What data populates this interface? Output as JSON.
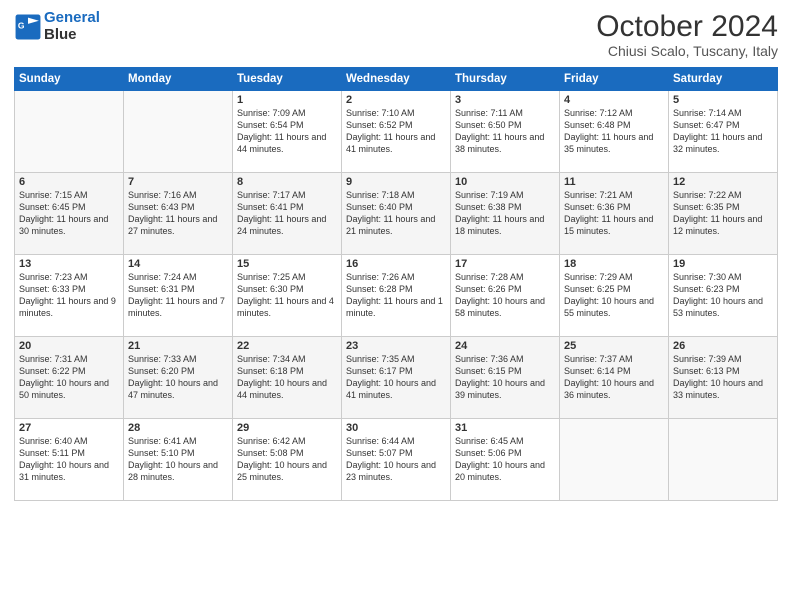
{
  "logo": {
    "line1": "General",
    "line2": "Blue"
  },
  "title": "October 2024",
  "subtitle": "Chiusi Scalo, Tuscany, Italy",
  "days_header": [
    "Sunday",
    "Monday",
    "Tuesday",
    "Wednesday",
    "Thursday",
    "Friday",
    "Saturday"
  ],
  "weeks": [
    [
      {
        "num": "",
        "text": ""
      },
      {
        "num": "",
        "text": ""
      },
      {
        "num": "1",
        "text": "Sunrise: 7:09 AM\nSunset: 6:54 PM\nDaylight: 11 hours and 44 minutes."
      },
      {
        "num": "2",
        "text": "Sunrise: 7:10 AM\nSunset: 6:52 PM\nDaylight: 11 hours and 41 minutes."
      },
      {
        "num": "3",
        "text": "Sunrise: 7:11 AM\nSunset: 6:50 PM\nDaylight: 11 hours and 38 minutes."
      },
      {
        "num": "4",
        "text": "Sunrise: 7:12 AM\nSunset: 6:48 PM\nDaylight: 11 hours and 35 minutes."
      },
      {
        "num": "5",
        "text": "Sunrise: 7:14 AM\nSunset: 6:47 PM\nDaylight: 11 hours and 32 minutes."
      }
    ],
    [
      {
        "num": "6",
        "text": "Sunrise: 7:15 AM\nSunset: 6:45 PM\nDaylight: 11 hours and 30 minutes."
      },
      {
        "num": "7",
        "text": "Sunrise: 7:16 AM\nSunset: 6:43 PM\nDaylight: 11 hours and 27 minutes."
      },
      {
        "num": "8",
        "text": "Sunrise: 7:17 AM\nSunset: 6:41 PM\nDaylight: 11 hours and 24 minutes."
      },
      {
        "num": "9",
        "text": "Sunrise: 7:18 AM\nSunset: 6:40 PM\nDaylight: 11 hours and 21 minutes."
      },
      {
        "num": "10",
        "text": "Sunrise: 7:19 AM\nSunset: 6:38 PM\nDaylight: 11 hours and 18 minutes."
      },
      {
        "num": "11",
        "text": "Sunrise: 7:21 AM\nSunset: 6:36 PM\nDaylight: 11 hours and 15 minutes."
      },
      {
        "num": "12",
        "text": "Sunrise: 7:22 AM\nSunset: 6:35 PM\nDaylight: 11 hours and 12 minutes."
      }
    ],
    [
      {
        "num": "13",
        "text": "Sunrise: 7:23 AM\nSunset: 6:33 PM\nDaylight: 11 hours and 9 minutes."
      },
      {
        "num": "14",
        "text": "Sunrise: 7:24 AM\nSunset: 6:31 PM\nDaylight: 11 hours and 7 minutes."
      },
      {
        "num": "15",
        "text": "Sunrise: 7:25 AM\nSunset: 6:30 PM\nDaylight: 11 hours and 4 minutes."
      },
      {
        "num": "16",
        "text": "Sunrise: 7:26 AM\nSunset: 6:28 PM\nDaylight: 11 hours and 1 minute."
      },
      {
        "num": "17",
        "text": "Sunrise: 7:28 AM\nSunset: 6:26 PM\nDaylight: 10 hours and 58 minutes."
      },
      {
        "num": "18",
        "text": "Sunrise: 7:29 AM\nSunset: 6:25 PM\nDaylight: 10 hours and 55 minutes."
      },
      {
        "num": "19",
        "text": "Sunrise: 7:30 AM\nSunset: 6:23 PM\nDaylight: 10 hours and 53 minutes."
      }
    ],
    [
      {
        "num": "20",
        "text": "Sunrise: 7:31 AM\nSunset: 6:22 PM\nDaylight: 10 hours and 50 minutes."
      },
      {
        "num": "21",
        "text": "Sunrise: 7:33 AM\nSunset: 6:20 PM\nDaylight: 10 hours and 47 minutes."
      },
      {
        "num": "22",
        "text": "Sunrise: 7:34 AM\nSunset: 6:18 PM\nDaylight: 10 hours and 44 minutes."
      },
      {
        "num": "23",
        "text": "Sunrise: 7:35 AM\nSunset: 6:17 PM\nDaylight: 10 hours and 41 minutes."
      },
      {
        "num": "24",
        "text": "Sunrise: 7:36 AM\nSunset: 6:15 PM\nDaylight: 10 hours and 39 minutes."
      },
      {
        "num": "25",
        "text": "Sunrise: 7:37 AM\nSunset: 6:14 PM\nDaylight: 10 hours and 36 minutes."
      },
      {
        "num": "26",
        "text": "Sunrise: 7:39 AM\nSunset: 6:13 PM\nDaylight: 10 hours and 33 minutes."
      }
    ],
    [
      {
        "num": "27",
        "text": "Sunrise: 6:40 AM\nSunset: 5:11 PM\nDaylight: 10 hours and 31 minutes."
      },
      {
        "num": "28",
        "text": "Sunrise: 6:41 AM\nSunset: 5:10 PM\nDaylight: 10 hours and 28 minutes."
      },
      {
        "num": "29",
        "text": "Sunrise: 6:42 AM\nSunset: 5:08 PM\nDaylight: 10 hours and 25 minutes."
      },
      {
        "num": "30",
        "text": "Sunrise: 6:44 AM\nSunset: 5:07 PM\nDaylight: 10 hours and 23 minutes."
      },
      {
        "num": "31",
        "text": "Sunrise: 6:45 AM\nSunset: 5:06 PM\nDaylight: 10 hours and 20 minutes."
      },
      {
        "num": "",
        "text": ""
      },
      {
        "num": "",
        "text": ""
      }
    ]
  ]
}
